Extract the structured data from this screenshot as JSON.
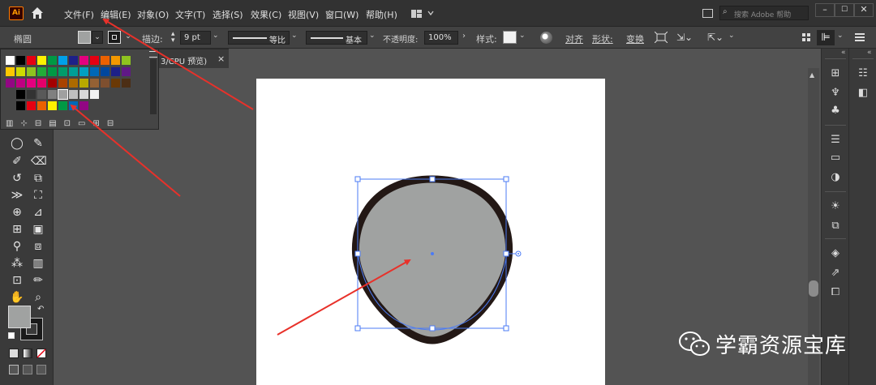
{
  "app": {
    "logo": "Ai"
  },
  "menu": [
    "文件(F)",
    "编辑(E)",
    "对象(O)",
    "文字(T)",
    "选择(S)",
    "效果(C)",
    "视图(V)",
    "窗口(W)",
    "帮助(H)"
  ],
  "search": {
    "placeholder": "搜索 Adobe 帮助"
  },
  "control": {
    "object_label": "椭圆",
    "stroke_label": "描边:",
    "stroke_value": "9 pt",
    "profile_label": "等比",
    "brush_label": "基本",
    "opacity_label": "不透明度:",
    "opacity_value": "100%",
    "style_label": "样式:",
    "align_label": "对齐",
    "shape_label": "形状:",
    "transform_label": "变换"
  },
  "doc_tab": {
    "title": "3/CPU 预览)",
    "close": "×"
  },
  "watermark": {
    "text": "学霸资源宝库"
  },
  "colors": {
    "fill": "#a0a2a1",
    "stroke": "#231815",
    "selection": "#4b7bf5",
    "arrow": "#e8312a",
    "ui_dark": "#323232"
  },
  "swatch_rows": [
    [
      "#ffffff",
      "#000000",
      "#e60012",
      "#fff100",
      "#009944",
      "#00a0e9",
      "#1d2088",
      "#e4007f",
      "#e60012",
      "#eb6100",
      "#f39800",
      "#8fc31f"
    ],
    [
      "#fcc800",
      "#cfdb00",
      "#8fc31f",
      "#22ac38",
      "#009944",
      "#009b6b",
      "#009e96",
      "#00a0c1",
      "#0068b7",
      "#00479d",
      "#1d2088",
      "#601986"
    ],
    [
      "#920783",
      "#be0081",
      "#e4007f",
      "#e5006a",
      "#a40000",
      "#a84200",
      "#ac6a00",
      "#b7aa00",
      "#946134",
      "#7e4f2f",
      "#6a3906",
      "#4c2e15"
    ],
    [
      "#000000",
      "#333333",
      "#595959",
      "#808080",
      "#a0a0a0",
      "#c0c0c0",
      "#d9d9d9",
      "#f2f2f2"
    ],
    [
      "#000000",
      "#e60012",
      "#eb6100",
      "#fff100",
      "#009944",
      "#0068b7",
      "#920783"
    ]
  ]
}
